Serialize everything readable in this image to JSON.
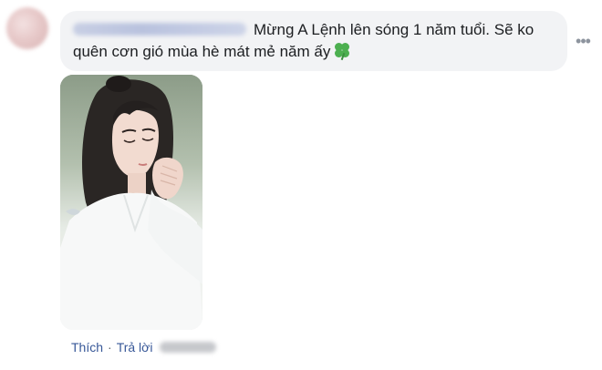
{
  "comment": {
    "text": "Mừng A Lệnh lên sóng 1 năm tuổi. Sẽ ko quên cơn gió mùa hè mát mẻ năm ấy",
    "emoji": "clover-icon",
    "more_icon": "more-dots-icon",
    "image": "portrait-photo"
  },
  "actions": {
    "like_label": "Thích",
    "separator": "·",
    "reply_label": "Trả lời"
  },
  "colors": {
    "bubble_bg": "#f2f3f5",
    "link": "#385898",
    "text": "#1c1e21",
    "meta": "#606770"
  }
}
